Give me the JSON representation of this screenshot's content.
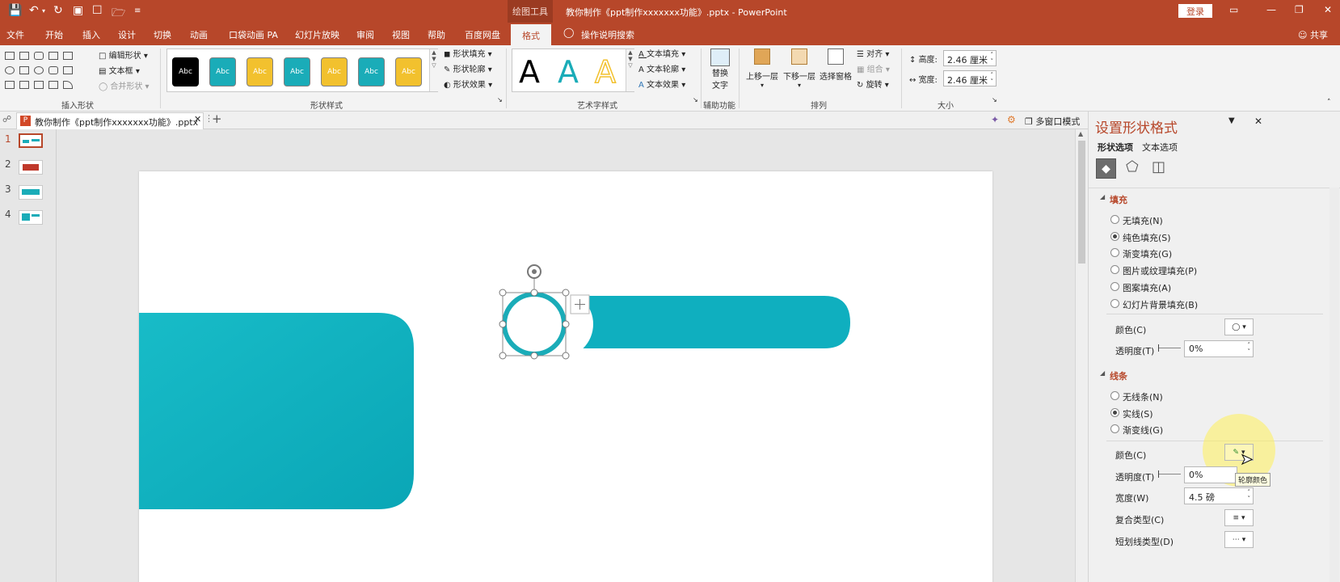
{
  "window": {
    "drawing_tools": "绘图工具",
    "title": "教你制作《ppt制作xxxxxxx功能》.pptx  -  PowerPoint",
    "login": "登录"
  },
  "tabs": [
    "文件",
    "开始",
    "插入",
    "设计",
    "切换",
    "动画",
    "口袋动画 PA",
    "幻灯片放映",
    "审阅",
    "视图",
    "帮助",
    "百度网盘",
    "格式",
    "操作说明搜索"
  ],
  "active_tab": "格式",
  "share": "共享",
  "ribbon": {
    "insert_shapes": {
      "edit_shape": "编辑形状",
      "text_box": "文本框",
      "merge_shapes": "合并形状",
      "label": "插入形状"
    },
    "shape_styles": {
      "thumb_text": "Abc",
      "fill": "形状填充",
      "outline": "形状轮廓",
      "effects": "形状效果",
      "label": "形状样式",
      "swatch_colors": [
        "#000000",
        "#1aacb8",
        "#f2c12e",
        "#1aacb8",
        "#f2c12e",
        "#1aacb8",
        "#f2c12e"
      ]
    },
    "wordart": {
      "glyph": "A",
      "text_fill": "文本填充",
      "text_outline": "文本轮廓",
      "text_effects": "文本效果",
      "label": "艺术字样式"
    },
    "accessibility": {
      "alt_text_line1": "替换",
      "alt_text_line2": "文字",
      "label": "辅助功能"
    },
    "arrange": {
      "bring_forward": "上移一层",
      "send_backward": "下移一层",
      "selection_pane": "选择窗格",
      "align": "对齐",
      "group": "组合",
      "rotate": "旋转",
      "label": "排列"
    },
    "size": {
      "height_label": "高度:",
      "height_value": "2.46 厘米",
      "width_label": "宽度:",
      "width_value": "2.46 厘米",
      "label": "大小"
    }
  },
  "document_tab": {
    "name": "教你制作《ppt制作xxxxxxx功能》.pptx",
    "multi_window": "多窗口模式"
  },
  "slides": [
    {
      "number": "1"
    },
    {
      "number": "2"
    },
    {
      "number": "3"
    },
    {
      "number": "4"
    }
  ],
  "accent_color": "#b7472a",
  "shape_color": "#1aacb8",
  "format_pane": {
    "title": "设置形状格式",
    "tab_shape": "形状选项",
    "tab_text": "文本选项",
    "fill_section": "填充",
    "fill_options": [
      "无填充(N)",
      "纯色填充(S)",
      "渐变填充(G)",
      "图片或纹理填充(P)",
      "图案填充(A)",
      "幻灯片背景填充(B)"
    ],
    "fill_selected": 1,
    "fill_color_label": "颜色(C)",
    "fill_transparency_label": "透明度(T)",
    "fill_transparency_value": "0%",
    "line_section": "线条",
    "line_options": [
      "无线条(N)",
      "实线(S)",
      "渐变线(G)"
    ],
    "line_selected": 1,
    "line_color_label": "颜色(C)",
    "line_transparency_label": "透明度(T)",
    "line_transparency_value": "0%",
    "line_width_label": "宽度(W)",
    "line_width_value": "4.5 磅",
    "compound_label": "复合类型(C)",
    "dash_label": "短划线类型(D)",
    "tooltip": "轮廓颜色"
  }
}
